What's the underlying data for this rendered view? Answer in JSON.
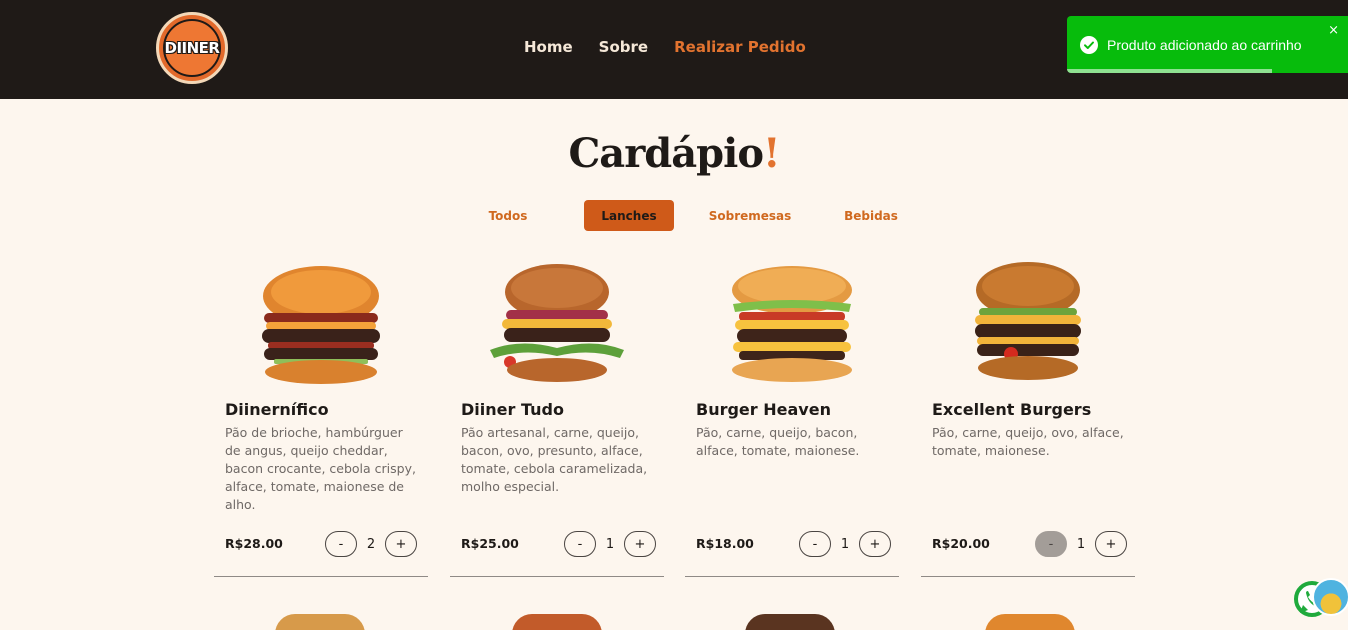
{
  "header": {
    "logo_text": "DIINER",
    "nav": [
      {
        "label": "Home"
      },
      {
        "label": "Sobre"
      },
      {
        "label": "Realizar Pedido"
      }
    ]
  },
  "toast": {
    "message": "Produto adicionado ao carrinho",
    "close": "×",
    "progress": 0.73,
    "color": "#07bc0c"
  },
  "menu": {
    "title": "Cardápio",
    "title_mark": "!",
    "tabs": [
      {
        "label": "Todos",
        "active": false
      },
      {
        "label": "Lanches",
        "active": true
      },
      {
        "label": "Sobremesas",
        "active": false
      },
      {
        "label": "Bebidas",
        "active": false
      }
    ],
    "items": [
      {
        "name": "Diinernífico",
        "description": "Pão de brioche, hambúrguer de angus, queijo cheddar, bacon crocante, cebola crispy, alface, tomate, maionese de alho.",
        "price": "R$28.00",
        "quantity": "2",
        "minus": "-",
        "plus": "+"
      },
      {
        "name": "Diiner Tudo",
        "description": "Pão artesanal, carne, queijo, bacon, ovo, presunto, alface, tomate, cebola caramelizada, molho especial.",
        "price": "R$25.00",
        "quantity": "1",
        "minus": "-",
        "plus": "+"
      },
      {
        "name": "Burger Heaven",
        "description": "Pão, carne, queijo, bacon, alface, tomate, maionese.",
        "price": "R$18.00",
        "quantity": "1",
        "minus": "-",
        "plus": "+"
      },
      {
        "name": "Excellent Burgers",
        "description": "Pão, carne, queijo, ovo, alface, tomate, maionese.",
        "price": "R$20.00",
        "quantity": "1",
        "minus": "-",
        "plus": "+"
      }
    ]
  },
  "colors": {
    "header_bg": "#1f1a17",
    "accent": "#e2732f",
    "page_bg": "#fdf6ee",
    "active_tab": "#cf5a19"
  }
}
